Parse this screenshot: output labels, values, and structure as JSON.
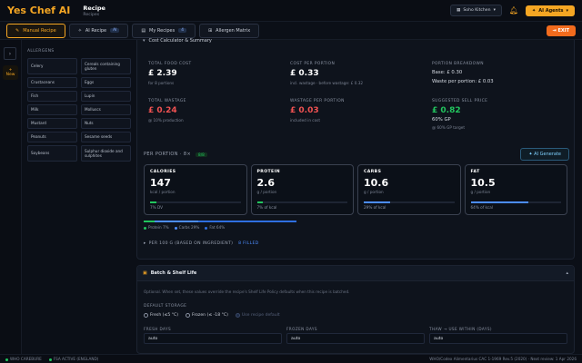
{
  "app": {
    "logo": "Yes Chef AI",
    "title": "Recipe",
    "subtitle": "Recipes",
    "kitchen": "Soho Kitchen",
    "agents_label": "AI Agents"
  },
  "tabs": [
    {
      "label": "Manual Recipe",
      "badge": ""
    },
    {
      "label": "AI Recipe",
      "badge": "AI"
    },
    {
      "label": "My Recipes",
      "badge": "4"
    },
    {
      "label": "Allergen Matrix",
      "badge": ""
    }
  ],
  "exit_label": "EXIT",
  "rail": {
    "new_label": "New"
  },
  "allergens": {
    "header": "ALLERGENS",
    "items": [
      "Celery",
      "Cereals containing gluten",
      "Crustaceans",
      "Eggs",
      "Fish",
      "Lupin",
      "Milk",
      "Molluscs",
      "Mustard",
      "Nuts",
      "Peanuts",
      "Sesame seeds",
      "Soybeans",
      "Sulphur dioxide and sulphites"
    ]
  },
  "cost": {
    "header": "Cost Calculator & Summary",
    "total_food_cost": {
      "label": "TOTAL FOOD COST",
      "value": "£ 2.39",
      "sub": "for 8 portions"
    },
    "cost_per_portion": {
      "label": "COST PER PORTION",
      "value": "£ 0.33",
      "sub": "incl. wastage · before wastage: £ 0.32"
    },
    "portion_breakdown": {
      "label": "PORTION BREAKDOWN",
      "base": "Base: £ 0.30",
      "waste": "Waste per portion: £ 0.03"
    },
    "total_wastage": {
      "label": "TOTAL WASTAGE",
      "value": "£ 0.24",
      "sub": "@ 10% production"
    },
    "wastage_per_portion": {
      "label": "WASTAGE PER PORTION",
      "value": "£ 0.03",
      "sub": "included in cost"
    },
    "suggested_price": {
      "label": "SUGGESTED SELL PRICE",
      "value": "£ 0.82",
      "gp": "60% GP",
      "sub": "@ 60% GP target"
    }
  },
  "per_portion": {
    "label": "PER PORTION · 8×",
    "badge": "8/8",
    "ai_generate": "✦ AI Generate"
  },
  "nutrition": [
    {
      "label": "CALORIES",
      "value": "147",
      "unit": "kcal / portion",
      "sub": "7% DV",
      "pct": 7,
      "color": "#22c55e"
    },
    {
      "label": "PROTEIN",
      "value": "2.6",
      "unit": "g / portion",
      "sub": "7% of kcal",
      "pct": 7,
      "color": "#22c55e"
    },
    {
      "label": "CARBS",
      "value": "10.6",
      "unit": "g / portion",
      "sub": "29% of kcal",
      "pct": 29,
      "color": "#4c8dff"
    },
    {
      "label": "FAT",
      "value": "10.5",
      "unit": "g / portion",
      "sub": "64% of kcal",
      "pct": 64,
      "color": "#4c8dff"
    }
  ],
  "macro_split": {
    "protein": {
      "label": "Protein 7%",
      "pct": 7,
      "color": "#22c55e"
    },
    "carbs": {
      "label": "Carbs 29%",
      "pct": 29,
      "color": "#4c8dff"
    },
    "fat": {
      "label": "Fat 64%",
      "pct": 64,
      "color": "#2f6fe0"
    }
  },
  "per100": {
    "label": "PER 100 G (BASED ON INGREDIENT)",
    "status": "8 FILLED"
  },
  "batch": {
    "title": "Batch & Shelf Life",
    "description": "Optional. When set, these values override the recipe's Shelf Life Policy defaults when this recipe is batched.",
    "default_storage_label": "DEFAULT STORAGE",
    "options": [
      "Fresh (≤5 °C)",
      "Frozen (≤ -18 °C)",
      "Use recipe default"
    ],
    "fresh_days_label": "FRESH DAYS",
    "fresh_days_value": "auto",
    "frozen_days_label": "FROZEN DAYS",
    "frozen_days_value": "auto",
    "thaw_label": "THAW → USE WITHIN (DAYS)",
    "thaw_value": "auto"
  },
  "footer": {
    "left1": "WHO CAREBURE",
    "left2": "FSA ACTIVE (ENGLAND)",
    "right": "WHO/Codex Alimentarius CAC 1-1969 Rev.5 (2020) · Next review: 1 Apr 2026"
  }
}
